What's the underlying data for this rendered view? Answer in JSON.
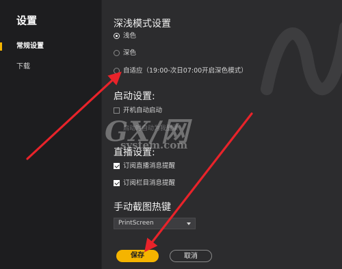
{
  "sidebar": {
    "title": "设置",
    "items": [
      {
        "label": "常规设置",
        "active": true
      },
      {
        "label": "下载",
        "active": false
      }
    ]
  },
  "theme": {
    "title": "深浅模式设置",
    "options": [
      {
        "label": "浅色",
        "checked": true
      },
      {
        "label": "深色",
        "checked": false
      },
      {
        "label": "自适应（19:00-次日07:00开启深色模式）",
        "checked": false
      }
    ]
  },
  "startup": {
    "title": "启动设置:",
    "checkbox_label": "开机自动启动",
    "checked": false,
    "hint": "启动时自动为我登录"
  },
  "live": {
    "title": "直播设置:",
    "options": [
      {
        "label": "订阅直播消息提醒",
        "checked": true
      },
      {
        "label": "订阅栏目消息提醒",
        "checked": true
      }
    ]
  },
  "hotkey": {
    "title": "手动截图热键",
    "selected": "PrintScreen"
  },
  "buttons": {
    "save": "保存",
    "cancel": "取消"
  },
  "watermark": {
    "logo": "GX/网",
    "url": "system.com"
  },
  "colors": {
    "accent": "#f5b400",
    "sidebar_bg": "#1d1d1f",
    "main_bg": "#2c2c2e",
    "arrow": "#e8232a"
  }
}
